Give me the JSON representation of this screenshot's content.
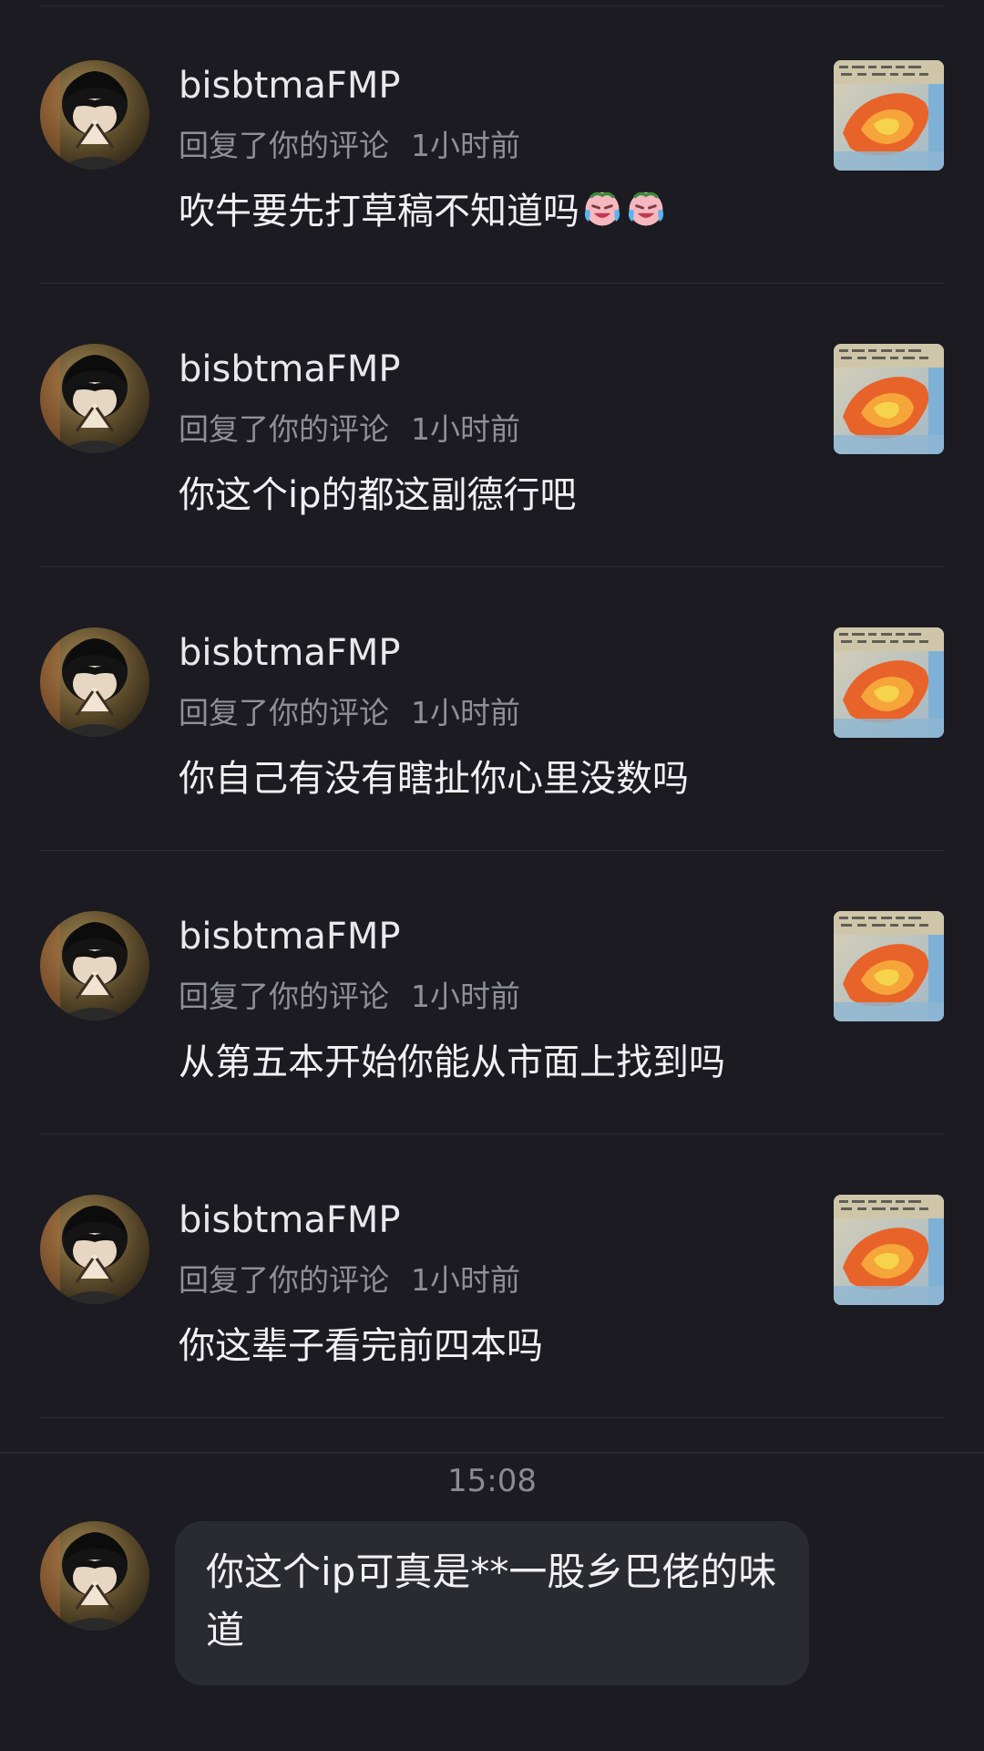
{
  "notifications": [
    {
      "username": "bisbtmaFMP",
      "action": "回复了你的评论",
      "time": "1小时前",
      "comment": "吹牛要先打草稿不知道吗",
      "emojis": [
        "crying-laughing-emoji",
        "crying-laughing-emoji"
      ]
    },
    {
      "username": "bisbtmaFMP",
      "action": "回复了你的评论",
      "time": "1小时前",
      "comment": "你这个ip的都这副德行吧"
    },
    {
      "username": "bisbtmaFMP",
      "action": "回复了你的评论",
      "time": "1小时前",
      "comment": "你自己有没有瞎扯你心里没数吗"
    },
    {
      "username": "bisbtmaFMP",
      "action": "回复了你的评论",
      "time": "1小时前",
      "comment": "从第五本开始你能从市面上找到吗"
    },
    {
      "username": "bisbtmaFMP",
      "action": "回复了你的评论",
      "time": "1小时前",
      "comment": "你这辈子看完前四本吗"
    }
  ],
  "chat": {
    "timestamp": "15:08",
    "message": "你这个ip可真是**一股乡巴佬的味道"
  },
  "colors": {
    "background": "#1b1b21",
    "bubble": "#2a2a31",
    "secondary_text": "#8f8f96"
  }
}
